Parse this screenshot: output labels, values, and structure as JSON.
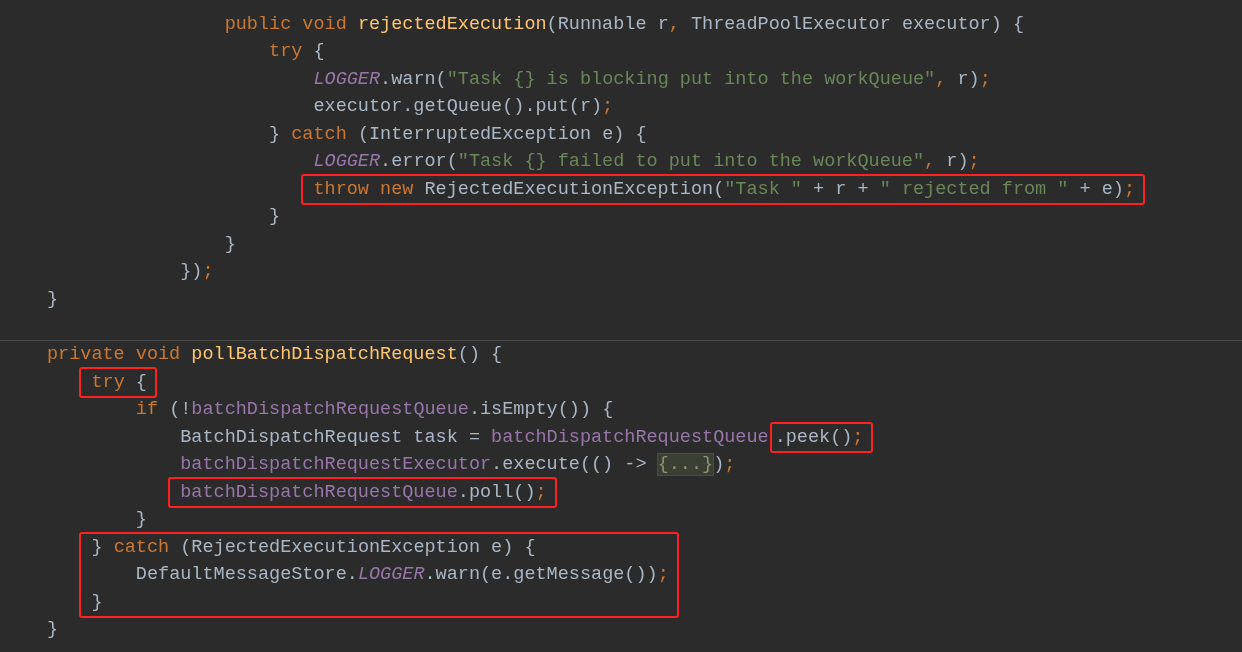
{
  "editor": {
    "blocks": [
      {
        "lines": [
          {
            "boxed": false,
            "tokens": [
              {
                "text": "                public void ",
                "kind": "keyword"
              },
              {
                "text": "rejectedExecution",
                "kind": "decl"
              },
              {
                "text": "(Runnable r",
                "kind": "plain"
              },
              {
                "text": ", ",
                "kind": "punct"
              },
              {
                "text": "ThreadPoolExecutor executor) {",
                "kind": "plain"
              }
            ]
          },
          {
            "boxed": false,
            "tokens": [
              {
                "text": "                    try ",
                "kind": "keyword"
              },
              {
                "text": "{",
                "kind": "plain"
              }
            ]
          },
          {
            "boxed": false,
            "tokens": [
              {
                "text": "                        LOGGER",
                "kind": "static"
              },
              {
                "text": ".warn(",
                "kind": "plain"
              },
              {
                "text": "\"Task {} is blocking put into the workQueue\"",
                "kind": "string"
              },
              {
                "text": ", ",
                "kind": "punct"
              },
              {
                "text": "r)",
                "kind": "plain"
              },
              {
                "text": ";",
                "kind": "punct"
              }
            ]
          },
          {
            "boxed": false,
            "tokens": [
              {
                "text": "                        executor.getQueue().put(r)",
                "kind": "plain"
              },
              {
                "text": ";",
                "kind": "punct"
              }
            ]
          },
          {
            "boxed": false,
            "tokens": [
              {
                "text": "                    } ",
                "kind": "plain"
              },
              {
                "text": "catch ",
                "kind": "keyword"
              },
              {
                "text": "(InterruptedException e) {",
                "kind": "plain"
              }
            ]
          },
          {
            "boxed": false,
            "tokens": [
              {
                "text": "                        LOGGER",
                "kind": "static"
              },
              {
                "text": ".error(",
                "kind": "plain"
              },
              {
                "text": "\"Task {} failed to put into the workQueue\"",
                "kind": "string"
              },
              {
                "text": ", ",
                "kind": "punct"
              },
              {
                "text": "r)",
                "kind": "plain"
              },
              {
                "text": ";",
                "kind": "punct"
              }
            ]
          },
          {
            "boxed": true,
            "tokens": [
              {
                "text": "                        throw new ",
                "kind": "keyword"
              },
              {
                "text": "RejectedExecutionException(",
                "kind": "plain"
              },
              {
                "text": "\"Task \"",
                "kind": "string"
              },
              {
                "text": " + r + ",
                "kind": "plain"
              },
              {
                "text": "\" rejected from \"",
                "kind": "string"
              },
              {
                "text": " + e)",
                "kind": "plain"
              },
              {
                "text": ";",
                "kind": "punct"
              }
            ]
          },
          {
            "boxed": false,
            "tokens": [
              {
                "text": "                    }",
                "kind": "plain"
              }
            ]
          },
          {
            "boxed": false,
            "tokens": [
              {
                "text": "                }",
                "kind": "plain"
              }
            ]
          },
          {
            "boxed": false,
            "tokens": [
              {
                "text": "            })",
                "kind": "plain"
              },
              {
                "text": ";",
                "kind": "punct"
              }
            ]
          },
          {
            "boxed": false,
            "tokens": [
              {
                "text": "}",
                "kind": "plain"
              }
            ]
          }
        ]
      },
      {
        "lines": [
          {
            "boxed": false,
            "tokens": [
              {
                "text": "private void ",
                "kind": "keyword"
              },
              {
                "text": "pollBatchDispatchRequest",
                "kind": "decl"
              },
              {
                "text": "() {",
                "kind": "plain"
              }
            ]
          },
          {
            "boxed": true,
            "tokens": [
              {
                "text": "    try ",
                "kind": "keyword"
              },
              {
                "text": "{",
                "kind": "plain"
              }
            ]
          },
          {
            "boxed": false,
            "tokens": [
              {
                "text": "        if ",
                "kind": "keyword"
              },
              {
                "text": "(!",
                "kind": "plain"
              },
              {
                "text": "batchDispatchRequestQueue",
                "kind": "field"
              },
              {
                "text": ".isEmpty()) {",
                "kind": "plain"
              }
            ]
          },
          {
            "boxed": false,
            "tokens": [
              {
                "text": "            BatchDispatchRequest task = ",
                "kind": "plain",
                "boxed": false
              },
              {
                "text": "batchDispatchRequestQueue",
                "kind": "field",
                "boxed": false
              },
              {
                "text": ".peek()",
                "kind": "plain",
                "boxed": true
              },
              {
                "text": ";",
                "kind": "punct",
                "boxed": true
              }
            ]
          },
          {
            "boxed": false,
            "tokens": [
              {
                "text": "            batchDispatchRequestExecutor",
                "kind": "field"
              },
              {
                "text": ".execute(() -> ",
                "kind": "plain"
              },
              {
                "text": "{...}",
                "kind": "fold"
              },
              {
                "text": ")",
                "kind": "plain"
              },
              {
                "text": ";",
                "kind": "punct"
              }
            ]
          },
          {
            "boxed": true,
            "tokens": [
              {
                "text": "            batchDispatchRequestQueue",
                "kind": "field"
              },
              {
                "text": ".poll()",
                "kind": "plain"
              },
              {
                "text": ";",
                "kind": "punct"
              }
            ]
          },
          {
            "boxed": false,
            "tokens": [
              {
                "text": "        }",
                "kind": "plain"
              }
            ]
          },
          {
            "boxed": true,
            "tokens": [
              {
                "text": "    } ",
                "kind": "plain"
              },
              {
                "text": "catch ",
                "kind": "keyword"
              },
              {
                "text": "(RejectedExecutionException e) {",
                "kind": "plain"
              }
            ]
          },
          {
            "boxed": true,
            "tokens": [
              {
                "text": "        DefaultMessageStore.",
                "kind": "plain"
              },
              {
                "text": "LOGGER",
                "kind": "static"
              },
              {
                "text": ".warn(e.getMessage())",
                "kind": "plain"
              },
              {
                "text": ";",
                "kind": "punct"
              }
            ]
          },
          {
            "boxed": true,
            "tokens": [
              {
                "text": "    }",
                "kind": "plain"
              }
            ]
          },
          {
            "boxed": false,
            "tokens": [
              {
                "text": "}",
                "kind": "plain"
              }
            ]
          }
        ]
      }
    ]
  }
}
